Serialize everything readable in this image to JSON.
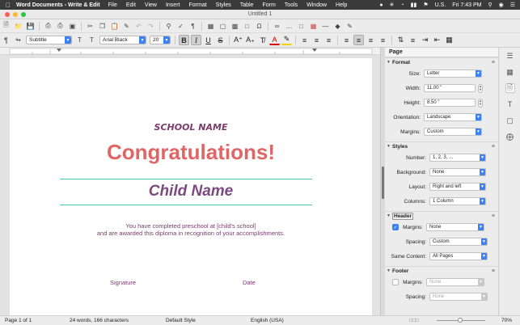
{
  "menubar": {
    "app_name": "Word Documents - Write & Edit",
    "items": [
      "File",
      "Edit",
      "View",
      "Insert",
      "Format",
      "Styles",
      "Table",
      "Form",
      "Tools",
      "Window",
      "Help"
    ],
    "locale": "U.S.",
    "clock": "Fri 7:43 PM"
  },
  "window": {
    "title": "Untitled 1"
  },
  "format_bar": {
    "style": "Subtitle",
    "font": "Arial Black",
    "size": "20",
    "bold_active": true,
    "italic_active": true
  },
  "document": {
    "school": "SCHOOL NAME",
    "congrats": "Congratulations!",
    "child": "Child Name",
    "line1": "You have completed preschool at [child's school]",
    "line2": "and are awarded this diploma in recognition of your accomplishments.",
    "signature": "Signature",
    "date": "Date",
    "colors": {
      "title_red": "#e06666",
      "purple": "#7b3b6e",
      "rule_teal": "#4fc3b8"
    }
  },
  "panel": {
    "title": "Page",
    "format": {
      "heading": "Format",
      "size_label": "Size:",
      "size": "Letter",
      "width_label": "Width:",
      "width": "11.00 \"",
      "height_label": "Height:",
      "height": "8.50 \"",
      "orientation_label": "Orientation:",
      "orientation": "Landscape",
      "margins_label": "Margins:",
      "margins": "Custom"
    },
    "styles": {
      "heading": "Styles",
      "number_label": "Number:",
      "number": "1, 2, 3, ...",
      "background_label": "Background:",
      "background": "None",
      "layout_label": "Layout:",
      "layout": "Right and left",
      "columns_label": "Columns:",
      "columns": "1 Column"
    },
    "header": {
      "heading": "Header",
      "enabled": true,
      "margins_label": "Margins:",
      "margins": "None",
      "spacing_label": "Spacing:",
      "spacing": "Custom",
      "same_label": "Same Content:",
      "same": "All Pages"
    },
    "footer": {
      "heading": "Footer",
      "enabled": false,
      "margins_label": "Margins:",
      "margins": "None",
      "spacing_label": "Spacing:",
      "spacing": "None"
    }
  },
  "status": {
    "page": "Page 1 of 1",
    "words": "24 words, 166 characters",
    "style": "Default Style",
    "language": "English (USA)",
    "zoom": "70%"
  }
}
